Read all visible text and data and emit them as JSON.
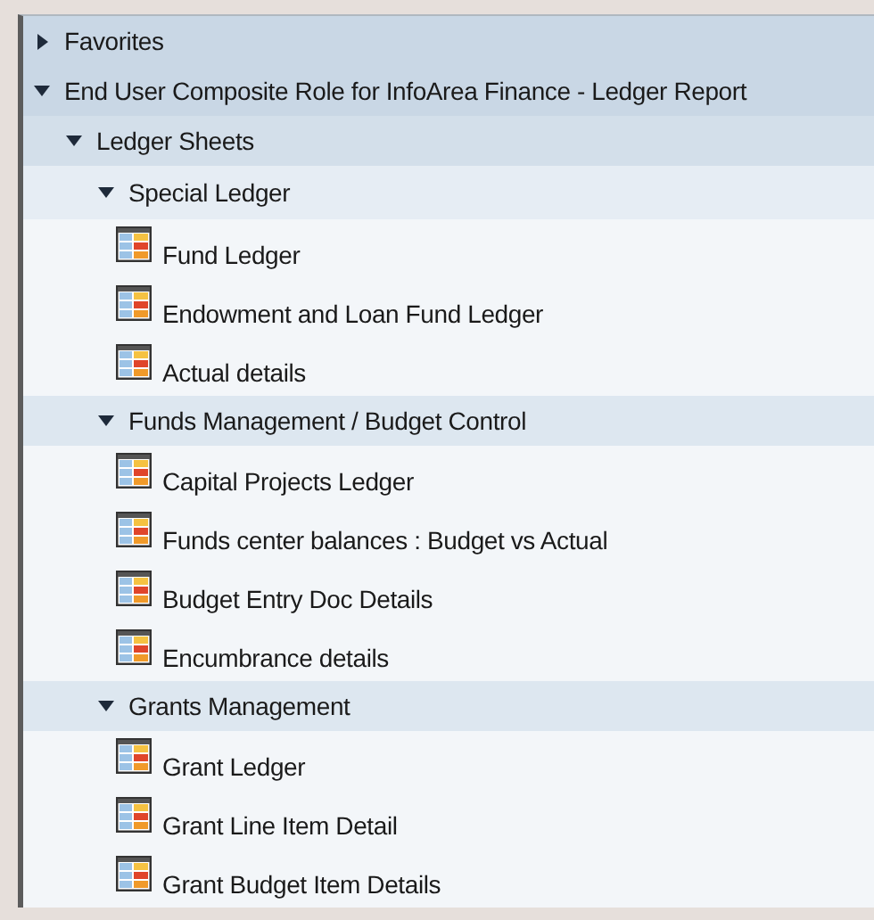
{
  "tree": [
    {
      "label": "Favorites",
      "kind": "folder",
      "expanded": false
    },
    {
      "label": "End User Composite Role for InfoArea Finance - Ledger Report",
      "kind": "folder",
      "expanded": true,
      "children": [
        {
          "label": "Ledger Sheets",
          "kind": "folder",
          "expanded": true,
          "children": [
            {
              "label": "Special Ledger",
              "kind": "folder",
              "expanded": true,
              "children": [
                {
                  "label": "Fund Ledger",
                  "kind": "report"
                },
                {
                  "label": "Endowment and Loan Fund Ledger",
                  "kind": "report"
                },
                {
                  "label": "Actual details",
                  "kind": "report"
                }
              ]
            },
            {
              "label": "Funds Management / Budget Control",
              "kind": "folder",
              "expanded": true,
              "children": [
                {
                  "label": "Capital Projects Ledger",
                  "kind": "report"
                },
                {
                  "label": "Funds center balances : Budget vs Actual",
                  "kind": "report"
                },
                {
                  "label": "Budget Entry Doc Details",
                  "kind": "report"
                },
                {
                  "label": "Encumbrance details",
                  "kind": "report"
                }
              ]
            },
            {
              "label": "Grants Management",
              "kind": "folder",
              "expanded": true,
              "children": [
                {
                  "label": "Grant Ledger",
                  "kind": "report"
                },
                {
                  "label": "Grant Line Item Detail",
                  "kind": "report"
                },
                {
                  "label": "Grant Budget Item Details",
                  "kind": "report"
                }
              ]
            }
          ]
        }
      ]
    }
  ]
}
